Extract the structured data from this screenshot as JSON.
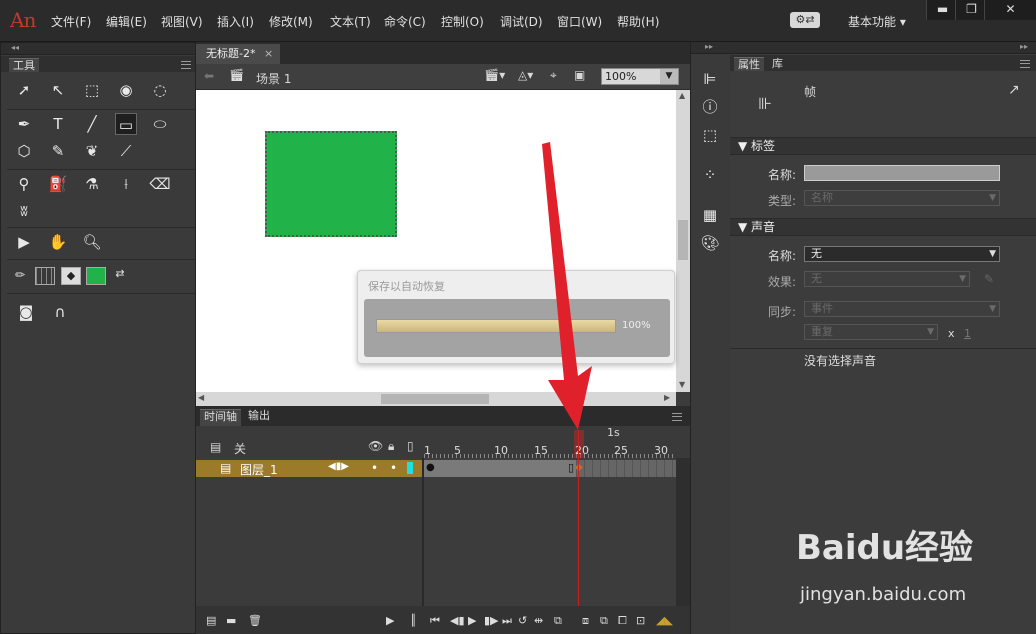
{
  "app": {
    "logo": "An",
    "menus": [
      "文件(F)",
      "编辑(E)",
      "视图(V)",
      "插入(I)",
      "修改(M)",
      "文本(T)",
      "命令(C)",
      "控制(O)",
      "调试(D)",
      "窗口(W)",
      "帮助(H)"
    ],
    "workspace": "基本功能",
    "window_buttons": [
      "▬",
      "❐",
      "✕"
    ]
  },
  "tools_panel": {
    "title": "工具"
  },
  "document": {
    "tab_label": "无标题-2*",
    "tab_close": "×",
    "scene_label": "场景 1",
    "zoom": "100%",
    "shape_color": "#21b24a"
  },
  "autosave_dialog": {
    "title": "保存以自动恢复",
    "progress": 1.0,
    "progress_text": "100%"
  },
  "timeline": {
    "tabs": [
      "时间轴",
      "输出"
    ],
    "header_label": "关",
    "layer_name": "图层_1",
    "ruler_second": "1s",
    "ruler_numbers": [
      "1",
      "5",
      "10",
      "15",
      "20",
      "25",
      "30"
    ],
    "current_frame": 20,
    "playhead_color": "#e02020"
  },
  "properties": {
    "tabs": [
      "属性",
      "库"
    ],
    "frame_label": "帧",
    "label_section": "标签",
    "name_label": "名称:",
    "type_label": "类型:",
    "type_value": "名称",
    "sound_section": "声音",
    "sound_name_label": "名称:",
    "sound_name_value": "无",
    "effect_label": "效果:",
    "effect_value": "无",
    "sync_label": "同步:",
    "sync_value": "事件",
    "repeat_value": "重复",
    "repeat_x": "x",
    "repeat_count": "1",
    "no_sound": "没有选择声音"
  },
  "watermark": {
    "main": "Baidu经验",
    "sub": "jingyan.baidu.com"
  },
  "colors": {
    "accent_red": "#e0202a",
    "layer_gold": "#9b7a2a"
  }
}
